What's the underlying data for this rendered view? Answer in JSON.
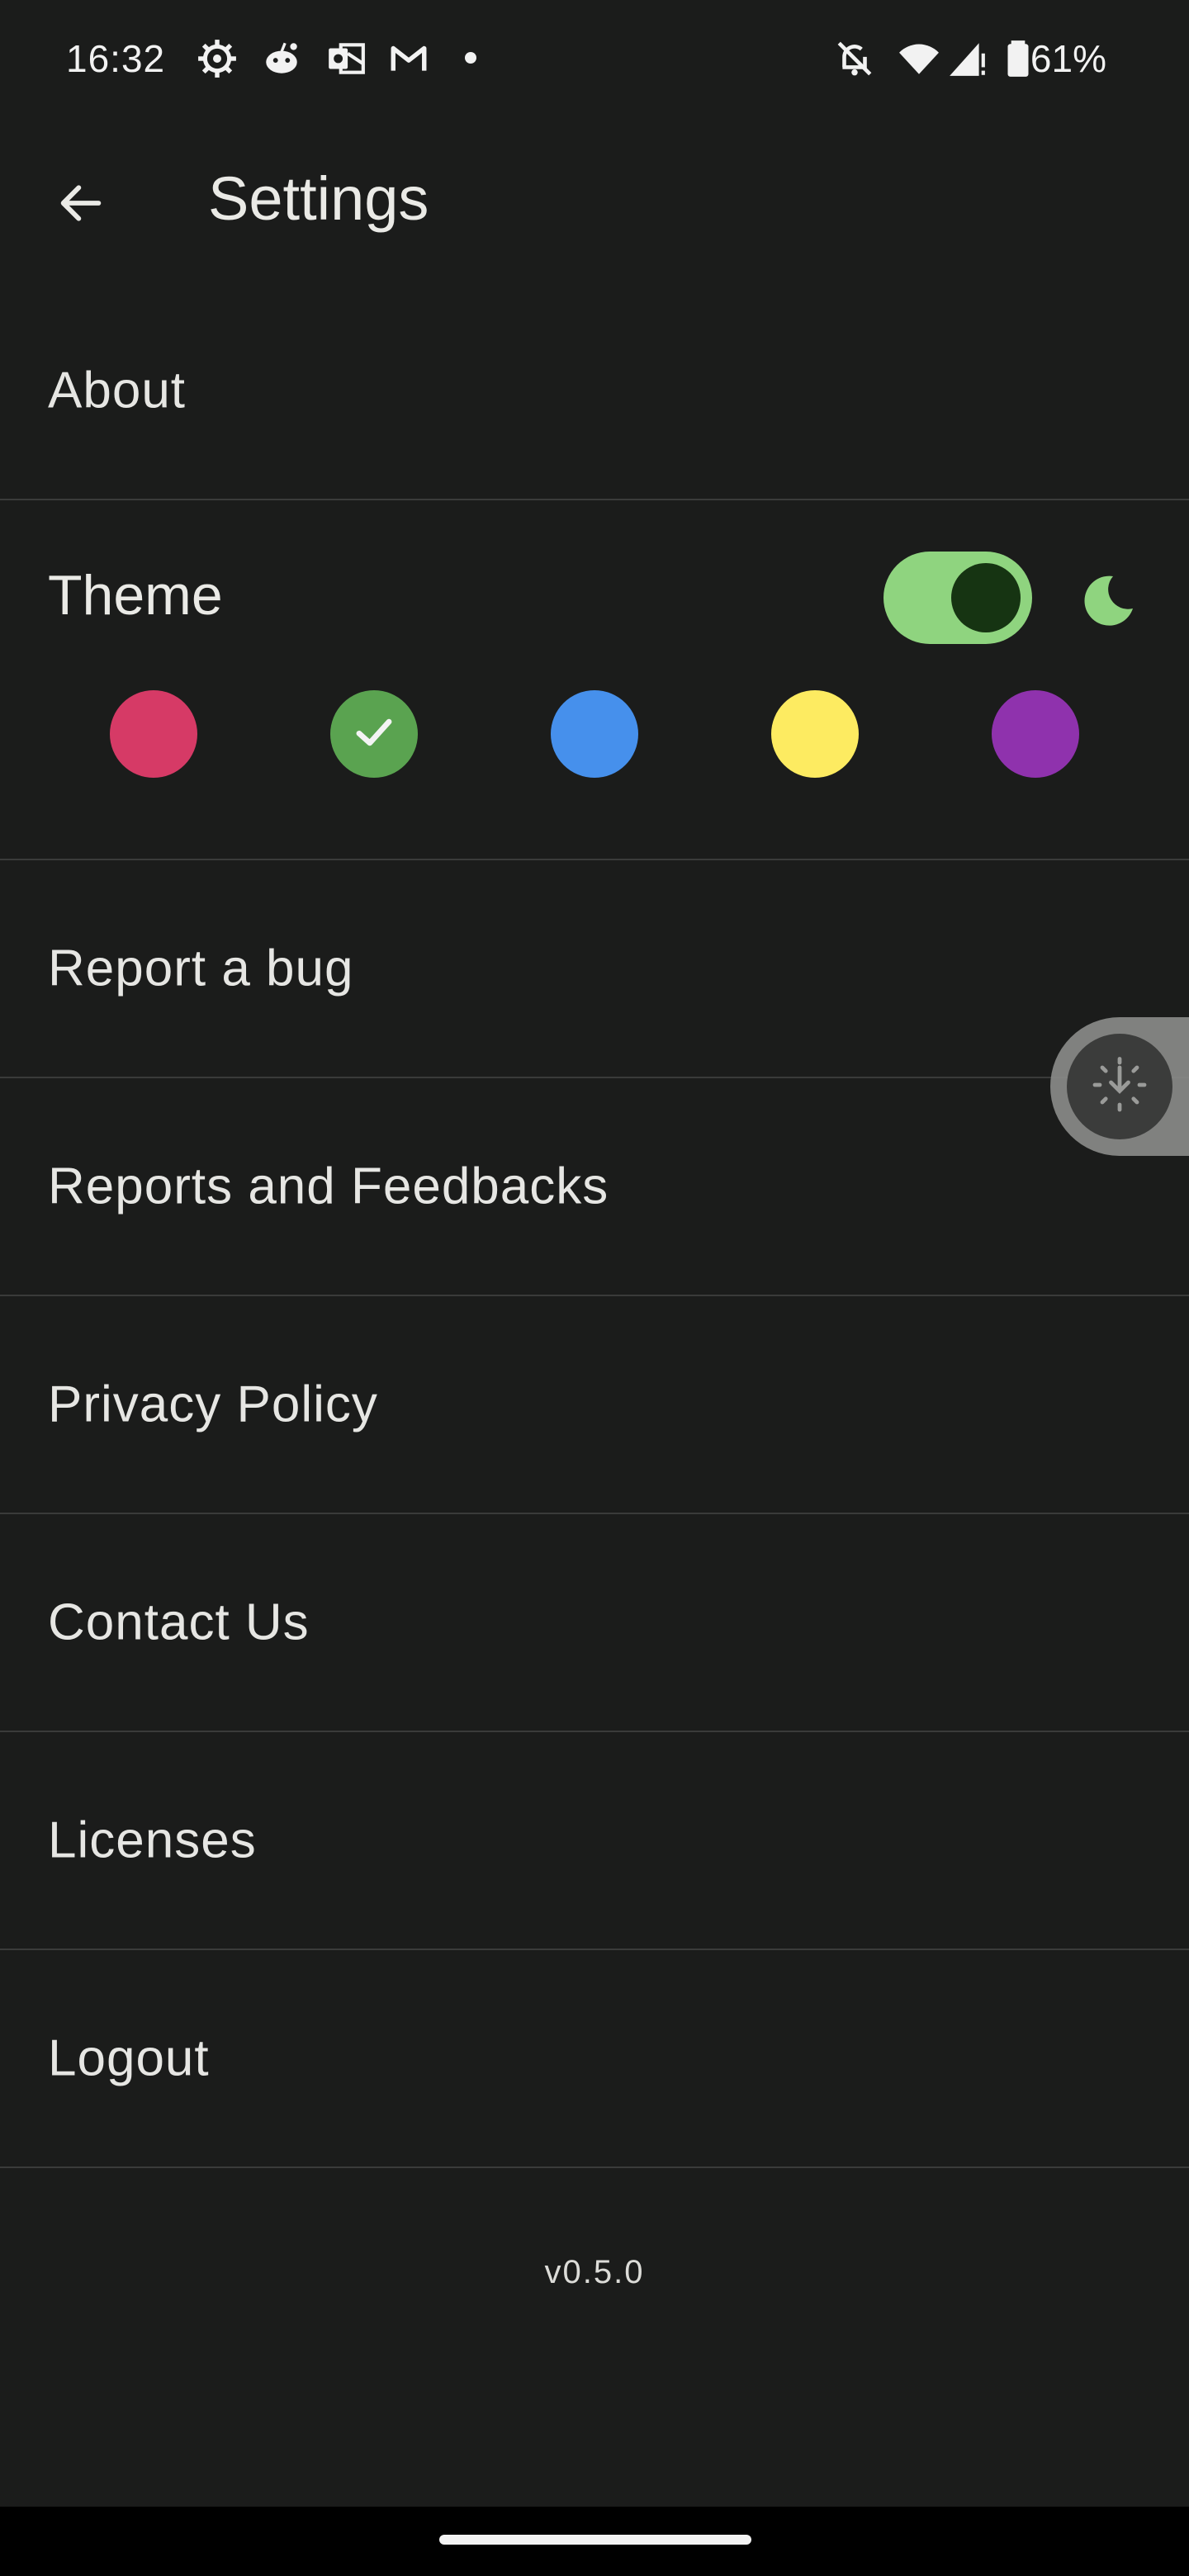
{
  "status_bar": {
    "time": "16:32",
    "battery": "61%",
    "icons_left": [
      "settings-gear-icon",
      "reddit-icon",
      "outlook-icon",
      "gmail-icon",
      "notification-dot-icon"
    ],
    "icons_right": [
      "do-not-disturb-bell-off-icon",
      "wifi-icon",
      "signal-icon",
      "battery-icon"
    ]
  },
  "app_bar": {
    "title": "Settings",
    "back_icon": "arrow-left-icon"
  },
  "rows": {
    "about": "About",
    "report_bug": "Report a bug",
    "reports_feedbacks": "Reports and Feedbacks",
    "privacy_policy": "Privacy Policy",
    "contact_us": "Contact Us",
    "licenses": "Licenses",
    "logout": "Logout"
  },
  "theme": {
    "label": "Theme",
    "dark_mode_enabled": true,
    "dark_mode_icon": "moon-icon",
    "selected_color": "green",
    "colors": [
      {
        "name": "pink",
        "hex": "#d63a66"
      },
      {
        "name": "green",
        "hex": "#5aa350"
      },
      {
        "name": "blue",
        "hex": "#4690ec"
      },
      {
        "name": "yellow",
        "hex": "#fdeb61"
      },
      {
        "name": "purple",
        "hex": "#8f32ad"
      }
    ]
  },
  "accent": {
    "toggle_track": "#8fd47f",
    "toggle_thumb": "#163412"
  },
  "version": "v0.5.0"
}
